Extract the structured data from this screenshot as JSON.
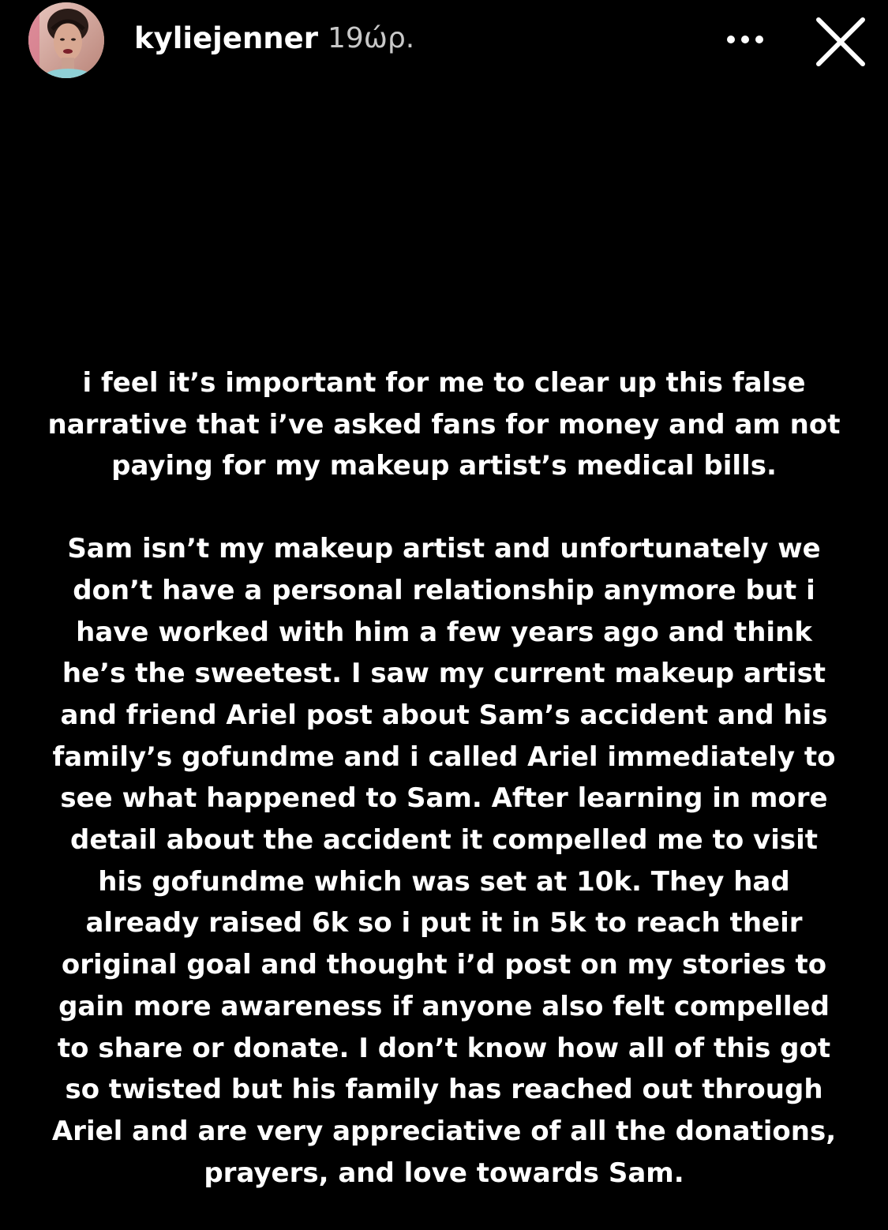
{
  "header": {
    "username": "kyliejenner",
    "timestamp": "19ώρ.",
    "more_icon": "more-horizontal-icon",
    "close_icon": "close-x-icon"
  },
  "story": {
    "paragraph_1": "i feel it’s important for me to clear up this false\nnarrative that i’ve asked fans for money and am not\npaying for my makeup artist’s medical bills.",
    "paragraph_2": "Sam isn’t my makeup artist and unfortunately we\ndon’t have a personal relationship anymore but i\nhave worked with him a few years ago and think\nhe’s the sweetest. I saw my current makeup artist\nand friend Ariel post about Sam’s accident and his\nfamily’s gofundme and i called Ariel immediately to\nsee what happened to Sam. After learning in more\ndetail about the accident it compelled me to visit\nhis gofundme which was set at 10k. They had\nalready raised 6k so i put it in 5k to reach their\noriginal goal and thought i’d post on my stories to\ngain more awareness if anyone also felt compelled\nto share or donate. I don’t know how all of this got\nso twisted but his family has reached out through\nAriel and are very appreciative of all the donations,\nprayers, and love towards Sam."
  },
  "colors": {
    "background": "#000000",
    "text": "#ffffff",
    "timestamp": "#c8c8c8"
  }
}
